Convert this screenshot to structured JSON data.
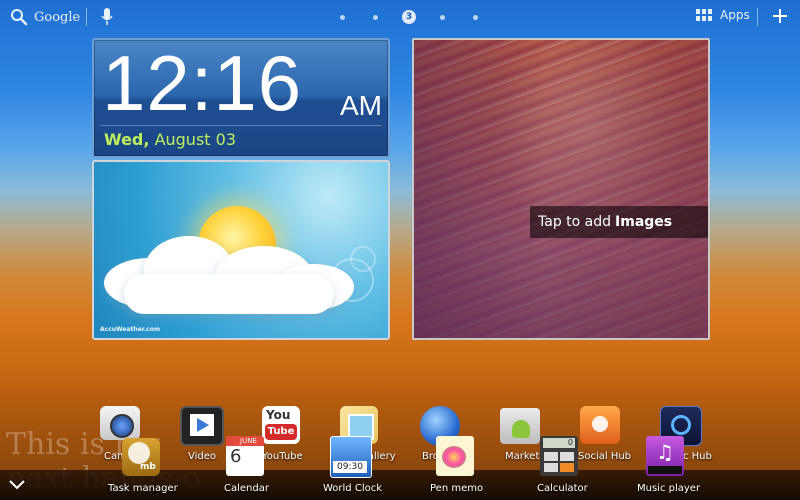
{
  "topbar": {
    "google_label": "Google",
    "page_indicator": [
      "",
      "",
      "3",
      "",
      ""
    ],
    "apps_label": "Apps"
  },
  "clock": {
    "time": "12:16",
    "ampm": "AM",
    "weekday": "Wed,",
    "date": "August 03"
  },
  "weather": {
    "provider": "AccuWeather.com"
  },
  "photo": {
    "prompt_prefix": "Tap to add",
    "prompt_bold": "Images"
  },
  "dock_row1": [
    {
      "label": "Camera",
      "icon": "camera-icon"
    },
    {
      "label": "Video",
      "icon": "video-icon"
    },
    {
      "label": "YouTube",
      "icon": "youtube-icon"
    },
    {
      "label": "Gallery",
      "icon": "gallery-icon"
    },
    {
      "label": "Browser",
      "icon": "browser-icon"
    },
    {
      "label": "Market",
      "icon": "market-icon"
    },
    {
      "label": "Social Hub",
      "icon": "social-hub-icon"
    },
    {
      "label": "Music Hub",
      "icon": "music-hub-icon"
    }
  ],
  "dock_row2": [
    {
      "label": "Task manager",
      "icon": "task-manager-icon",
      "badge": "mb"
    },
    {
      "label": "Calendar",
      "icon": "calendar-icon",
      "month": "JUNE",
      "day": "6"
    },
    {
      "label": "World Clock",
      "icon": "world-clock-icon",
      "time": "09:30"
    },
    {
      "label": "Pen memo",
      "icon": "pen-memo-icon"
    },
    {
      "label": "Calculator",
      "icon": "calculator-icon",
      "display": "0"
    },
    {
      "label": "Music player",
      "icon": "music-player-icon"
    }
  ],
  "watermark": {
    "line1": "This is my",
    "line2": "next hands-o"
  },
  "colors": {
    "clock_date": "#bff05a",
    "clock_bg": "#2c66ad"
  }
}
